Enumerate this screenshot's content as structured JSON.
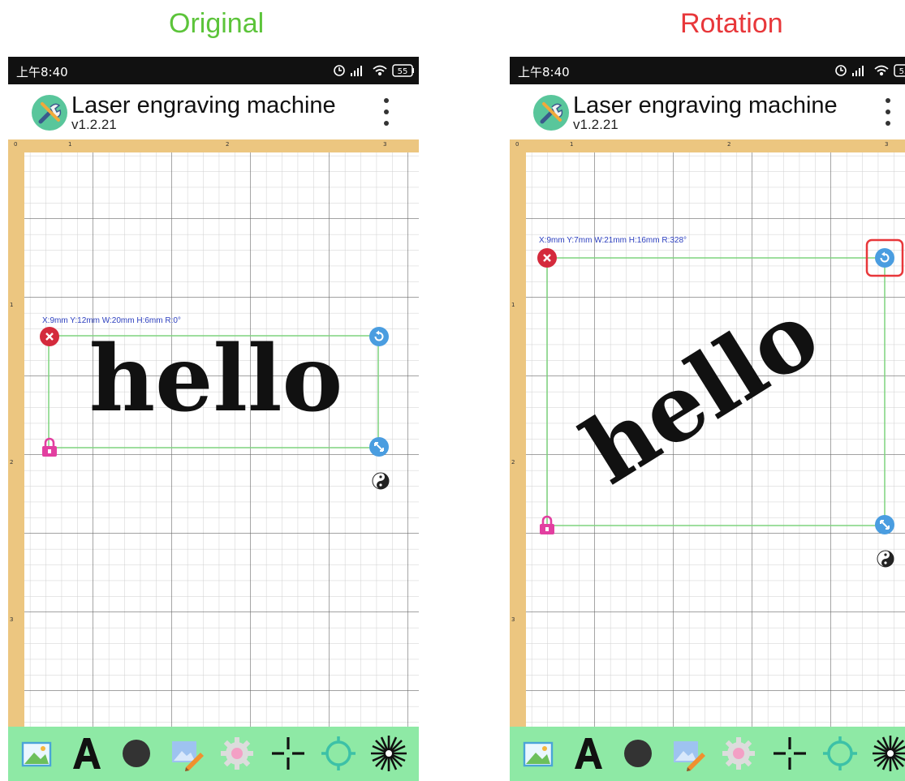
{
  "captions": {
    "left": "Original",
    "right": "Rotation"
  },
  "status_bar": {
    "time": "上午8:40",
    "battery": "55"
  },
  "app": {
    "title": "Laser engraving machine",
    "version": "v1.2.21",
    "menu_icon": "more-vert-icon"
  },
  "ruler": {
    "top_labels": [
      "0",
      "1",
      "2",
      "3"
    ],
    "left_labels": [
      "1",
      "2",
      "3"
    ]
  },
  "left_panel": {
    "dims": {
      "x": "X:9mm",
      "y": "Y:12mm",
      "w": "W:20mm",
      "h": "H:6mm",
      "r": "R:0°"
    },
    "text": "hello",
    "rotation_deg": 0
  },
  "right_panel": {
    "dims": {
      "x": "X:9mm",
      "y": "Y:7mm",
      "w": "W:21mm",
      "h": "H:16mm",
      "r": "R:328°"
    },
    "text": "hello",
    "rotation_deg": 328
  },
  "toolbar": [
    "image-icon",
    "text-icon",
    "shape-circle-icon",
    "sketch-icon",
    "settings-gear-icon",
    "crosshair-icon",
    "positioning-icon",
    "laser-burst-icon"
  ],
  "colors": {
    "delete": "#d42a3c",
    "rotate": "#4a9de0",
    "lock": "#e23fa0",
    "toolbar_bg": "#8ee9a5",
    "ruler": "#ecc680",
    "frame": "#7ed37e"
  }
}
